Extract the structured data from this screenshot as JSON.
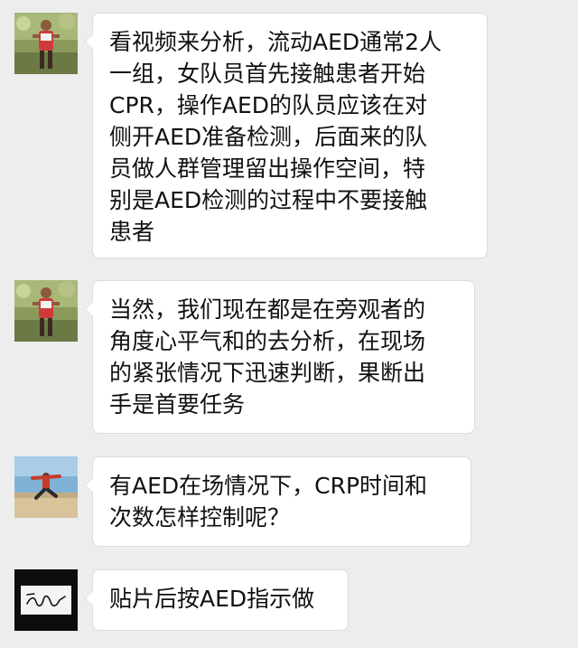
{
  "messages": [
    {
      "avatar": "runner-avatar-icon",
      "lines": [
        "看视频来分析，流动AED通常2人",
        "一组，女队员首先接触患者开始",
        "CPR，操作AED的队员应该在对",
        "侧开AED准备检测，后面来的队",
        "员做人群管理留出操作空间，特",
        "别是AED检测的过程中不要接触",
        "患者"
      ]
    },
    {
      "avatar": "runner-avatar-icon",
      "lines": [
        "当然，我们现在都是在旁观者的",
        "角度心平气和的去分析，在现场",
        "的紧张情况下迅速判断，果断出",
        "手是首要任务"
      ]
    },
    {
      "avatar": "jumping-person-avatar-icon",
      "lines": [
        "有AED在场情况下，CRP时间和",
        "次数怎样控制呢？"
      ]
    },
    {
      "avatar": "signature-avatar-icon",
      "lines": [
        "贴片后按AED指示做"
      ]
    }
  ]
}
